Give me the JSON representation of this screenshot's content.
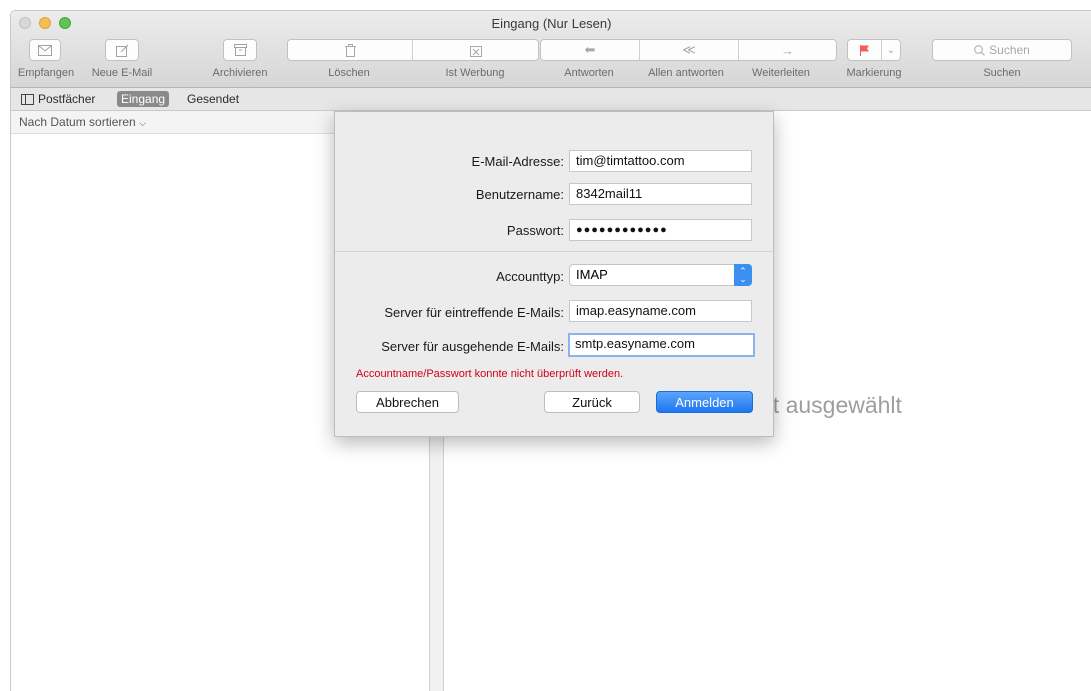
{
  "window": {
    "title": "Eingang (Nur Lesen)"
  },
  "toolbar": {
    "receive_label": "Empfangen",
    "new_mail_label": "Neue E-Mail",
    "archive_label": "Archivieren",
    "delete_label": "Löschen",
    "junk_label": "Ist Werbung",
    "reply_label": "Antworten",
    "reply_all_label": "Allen antworten",
    "forward_label": "Weiterleiten",
    "flag_label": "Markierung",
    "search_placeholder": "Suchen",
    "search_label": "Suchen"
  },
  "favorites": {
    "mailboxes_label": "Postfächer",
    "inbox_label": "Eingang",
    "sent_label": "Gesendet"
  },
  "message_list": {
    "sort_label": "Nach Datum sortieren"
  },
  "viewer": {
    "empty_text": "nt ausgewählt"
  },
  "dialog": {
    "email_label": "E-Mail-Adresse:",
    "email_value": "tim@timtattoo.com",
    "username_label": "Benutzername:",
    "username_value": "8342mail11",
    "password_label": "Passwort:",
    "password_value": "●●●●●●●●●●●●",
    "account_type_label": "Accounttyp:",
    "account_type_value": "IMAP",
    "incoming_label": "Server für eintreffende E-Mails:",
    "incoming_value": "imap.easyname.com",
    "outgoing_label": "Server für ausgehende E-Mails:",
    "outgoing_value": "smtp.easyname.com",
    "error_text": "Accountname/Passwort konnte nicht überprüft werden.",
    "cancel_label": "Abbrechen",
    "back_label": "Zurück",
    "signin_label": "Anmelden"
  },
  "colors": {
    "accent": "#1e76f0",
    "error": "#d0021b",
    "flag": "#f25d5d"
  }
}
